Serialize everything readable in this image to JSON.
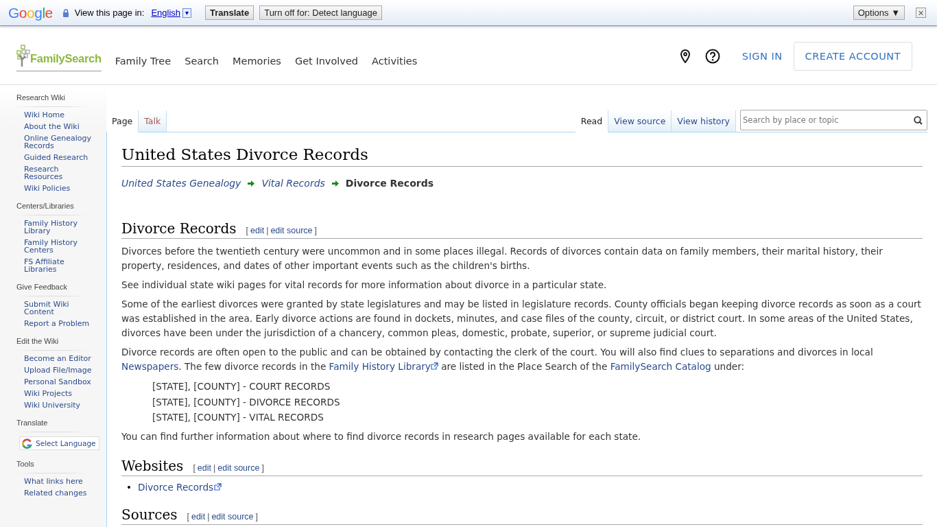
{
  "translate_bar": {
    "logo": "Google",
    "prompt": "View this page in:",
    "language": "English",
    "language_caret": "▾",
    "translate_button": "Translate",
    "turn_off_button": "Turn off for: Detect language",
    "options_button": "Options ▼",
    "close": "×"
  },
  "header": {
    "logo": "FamilySearch",
    "nav": [
      "Family Tree",
      "Search",
      "Memories",
      "Get Involved",
      "Activities"
    ],
    "sign_in": "SIGN IN",
    "create_account": "CREATE ACCOUNT"
  },
  "sidebar": {
    "sections": [
      {
        "title": "Research Wiki",
        "items": [
          "Wiki Home",
          "About the Wiki",
          "Online Genealogy Records",
          "Guided Research",
          "Research Resources",
          "Wiki Policies"
        ]
      },
      {
        "title": "Centers/Libraries",
        "items": [
          "Family History Library",
          "Family History Centers",
          "FS Affiliate Libraries"
        ]
      },
      {
        "title": "Give Feedback",
        "items": [
          "Submit Wiki Content",
          "Report a Problem"
        ]
      },
      {
        "title": "Edit the Wiki",
        "items": [
          "Become an Editor",
          "Upload File/Image",
          "Personal Sandbox",
          "Wiki Projects",
          "Wiki University"
        ]
      },
      {
        "title": "Translate",
        "widget": "Select Language"
      },
      {
        "title": "Tools",
        "items": [
          "What links here",
          "Related changes"
        ]
      }
    ]
  },
  "page_tabs": [
    {
      "label": "Page",
      "selected": true,
      "missing": false
    },
    {
      "label": "Talk",
      "selected": false,
      "missing": true
    }
  ],
  "view_tabs": [
    {
      "label": "Read",
      "selected": true
    },
    {
      "label": "View source",
      "selected": false
    },
    {
      "label": "View history",
      "selected": false
    }
  ],
  "search": {
    "placeholder": "Search by place or topic"
  },
  "title": "United States Divorce Records",
  "breadcrumb": [
    {
      "label": "United States Genealogy",
      "current": false
    },
    {
      "label": "Vital Records",
      "current": false
    },
    {
      "label": "Divorce Records",
      "current": true
    }
  ],
  "sections": [
    {
      "heading": "Divorce Records",
      "edit_links": {
        "open": "[",
        "items": [
          "edit",
          "edit source"
        ],
        "separator": "|",
        "close": "]"
      },
      "blocks": [
        {
          "kind": "paragraph",
          "parts": [
            {
              "text": "Divorces before the twentieth century were uncommon and in some places illegal. Records of divorces contain data on family members, their marital history, their property, residences, and dates of other important events such as the children's births."
            }
          ]
        },
        {
          "kind": "paragraph",
          "parts": [
            {
              "text": "See individual state wiki pages for vital records for more information about divorce in a particular state."
            }
          ]
        },
        {
          "kind": "paragraph",
          "parts": [
            {
              "text": "Some of the earliest divorces were granted by state legislatures and may be listed in legislature records. County officials began keeping divorce records as soon as a court was established in the area. Early divorce actions are found in dockets, minutes, and case files of the county, circuit, or district court. In some areas of the United States, divorces have been under the jurisdiction of a chancery, common pleas, domestic, probate, superior, or supreme judicial court."
            }
          ]
        },
        {
          "kind": "paragraph",
          "parts": [
            {
              "text": "Divorce records are often open to the public and can be obtained by contacting the clerk of the court. You will also find clues to separations and divorces in local "
            },
            {
              "link": "Newspapers",
              "external": false
            },
            {
              "text": ". The few divorce records in the "
            },
            {
              "link": "Family History Library",
              "external": true
            },
            {
              "text": " are listed in the Place Search of the "
            },
            {
              "link": "FamilySearch Catalog",
              "external": false
            },
            {
              "text": " under:"
            }
          ]
        },
        {
          "kind": "indented",
          "lines": [
            "[STATE], [COUNTY] - COURT RECORDS",
            "[STATE], [COUNTY] - DIVORCE RECORDS",
            "[STATE], [COUNTY] - VITAL RECORDS"
          ]
        },
        {
          "kind": "paragraph",
          "parts": [
            {
              "text": "You can find further information about where to find divorce records in research pages available for each state."
            }
          ]
        }
      ]
    },
    {
      "heading": "Websites",
      "edit_links": {
        "open": "[",
        "items": [
          "edit",
          "edit source"
        ],
        "separator": "|",
        "close": "]"
      },
      "blocks": [
        {
          "kind": "bullets",
          "items": [
            {
              "marker": "•",
              "link": "Divorce Records",
              "external": true
            }
          ]
        }
      ]
    },
    {
      "heading": "Sources",
      "edit_links": {
        "open": "[",
        "items": [
          "edit",
          "edit source"
        ],
        "separator": "|",
        "close": "]"
      }
    }
  ]
}
